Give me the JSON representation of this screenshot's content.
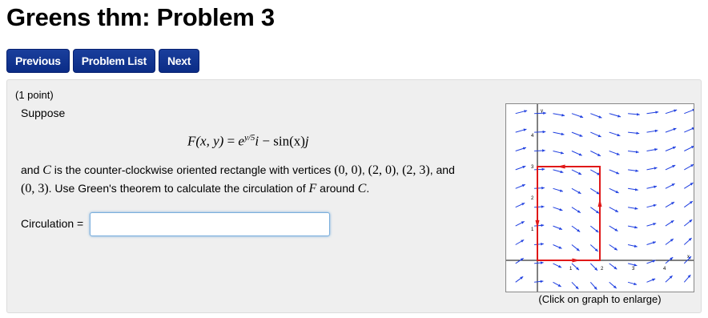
{
  "page": {
    "title": "Greens thm: Problem 3"
  },
  "nav": {
    "previous": "Previous",
    "problem_list": "Problem List",
    "next": "Next"
  },
  "problem": {
    "points": "(1 point)",
    "suppose": "Suppose",
    "formula": {
      "lhs": "F(x, y)",
      "equals": " = ",
      "e": "e",
      "exponent": "y/5",
      "i": "i",
      "minus": " − sin(x)",
      "j": "j"
    },
    "line1": {
      "pre": "and ",
      "C": "C",
      "mid": " is the counter-clockwise oriented rectangle with vertices ",
      "v1": "(0, 0)",
      "sep1": ", ",
      "v2": "(2, 0)",
      "sep2": ", ",
      "v3": "(2, 3)",
      "end": ", and"
    },
    "line2": {
      "v4": "(0, 3)",
      "mid": ". Use Green's theorem to calculate the circulation of ",
      "F": "F",
      "around": " around ",
      "C": "C",
      "end": "."
    },
    "circulation_label": "Circulation =",
    "circulation_value": "",
    "graph_caption": "(Click on graph to enlarge)",
    "graph": {
      "x_axis_label": "x",
      "y_axis_label": "y",
      "x_ticks": [
        "1",
        "2",
        "3",
        "4"
      ],
      "y_ticks": [
        "1",
        "2",
        "3",
        "4"
      ],
      "xlim": [
        -1,
        5
      ],
      "ylim": [
        -1,
        5
      ],
      "rectangle": [
        [
          0,
          0
        ],
        [
          2,
          0
        ],
        [
          2,
          3
        ],
        [
          0,
          3
        ]
      ],
      "arrow_color": "#1f3fe0",
      "rect_color": "#e01818"
    }
  }
}
